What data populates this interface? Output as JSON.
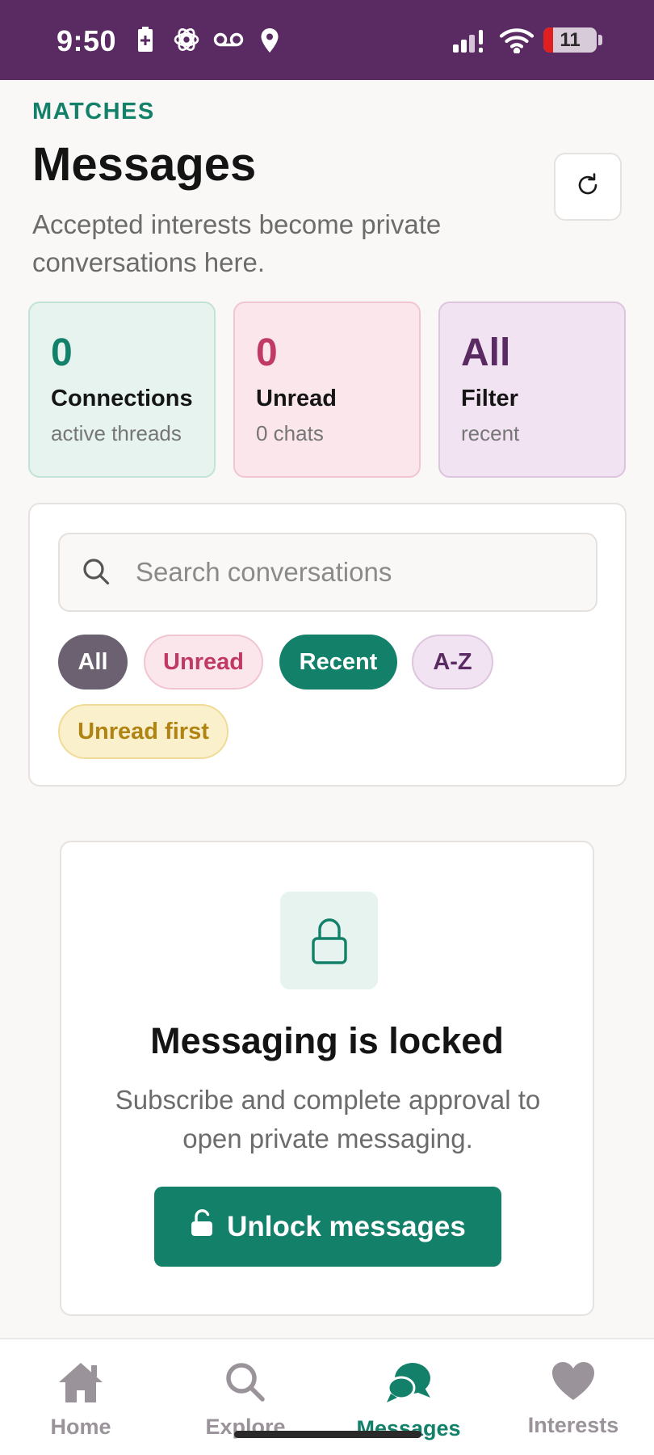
{
  "status_bar": {
    "time": "9:50",
    "battery": "11"
  },
  "header": {
    "eyebrow": "MATCHES",
    "title": "Messages",
    "subtitle": "Accepted interests become private conversations here."
  },
  "stats": [
    {
      "value": "0",
      "label": "Connections",
      "sub": "active threads"
    },
    {
      "value": "0",
      "label": "Unread",
      "sub": "0 chats"
    },
    {
      "value": "All",
      "label": "Filter",
      "sub": "recent"
    }
  ],
  "search": {
    "placeholder": "Search conversations",
    "value": ""
  },
  "chips": {
    "all": "All",
    "unread": "Unread",
    "recent": "Recent",
    "az": "A-Z",
    "unread_first": "Unread first",
    "selected": "Recent"
  },
  "locked": {
    "title": "Messaging is locked",
    "body": "Subscribe and complete approval to open private messaging.",
    "button": "Unlock messages"
  },
  "tabs": [
    {
      "label": "Home",
      "icon": "home-icon"
    },
    {
      "label": "Explore",
      "icon": "search-icon"
    },
    {
      "label": "Messages",
      "icon": "chat-icon"
    },
    {
      "label": "Interests",
      "icon": "heart-icon"
    }
  ],
  "active_tab": "Messages",
  "colors": {
    "brand_purple": "#5a2b62",
    "accent_green": "#13806a",
    "accent_pink": "#c03a65",
    "accent_gold": "#b08413"
  }
}
